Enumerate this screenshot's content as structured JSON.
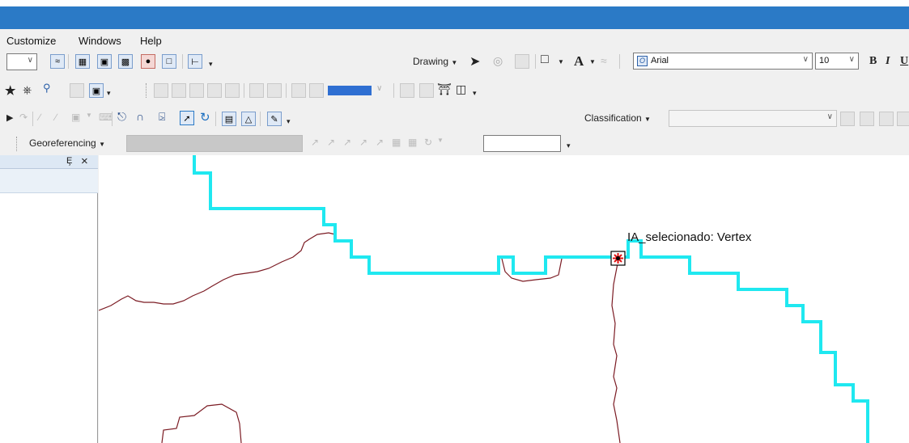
{
  "menu": {
    "customize": "Customize",
    "windows": "Windows",
    "help": "Help"
  },
  "drawing_toolbar": {
    "drawing_label": "Drawing",
    "font_name": "Arial",
    "font_size": "10",
    "bold": "B",
    "italic": "I",
    "underline": "U",
    "text_tool": "A"
  },
  "classification_toolbar": {
    "label": "Classification"
  },
  "georeferencing_toolbar": {
    "label": "Georeferencing"
  },
  "dock_panel": {
    "pin_glyph": "Ȩ",
    "close_glyph": "×"
  },
  "map": {
    "vertex_label": "IA_selecionado: Vertex",
    "colors": {
      "selected_polygon": "#1fe8f0",
      "boundary": "#7b1b23",
      "vertex_marker": "#e01010"
    }
  }
}
